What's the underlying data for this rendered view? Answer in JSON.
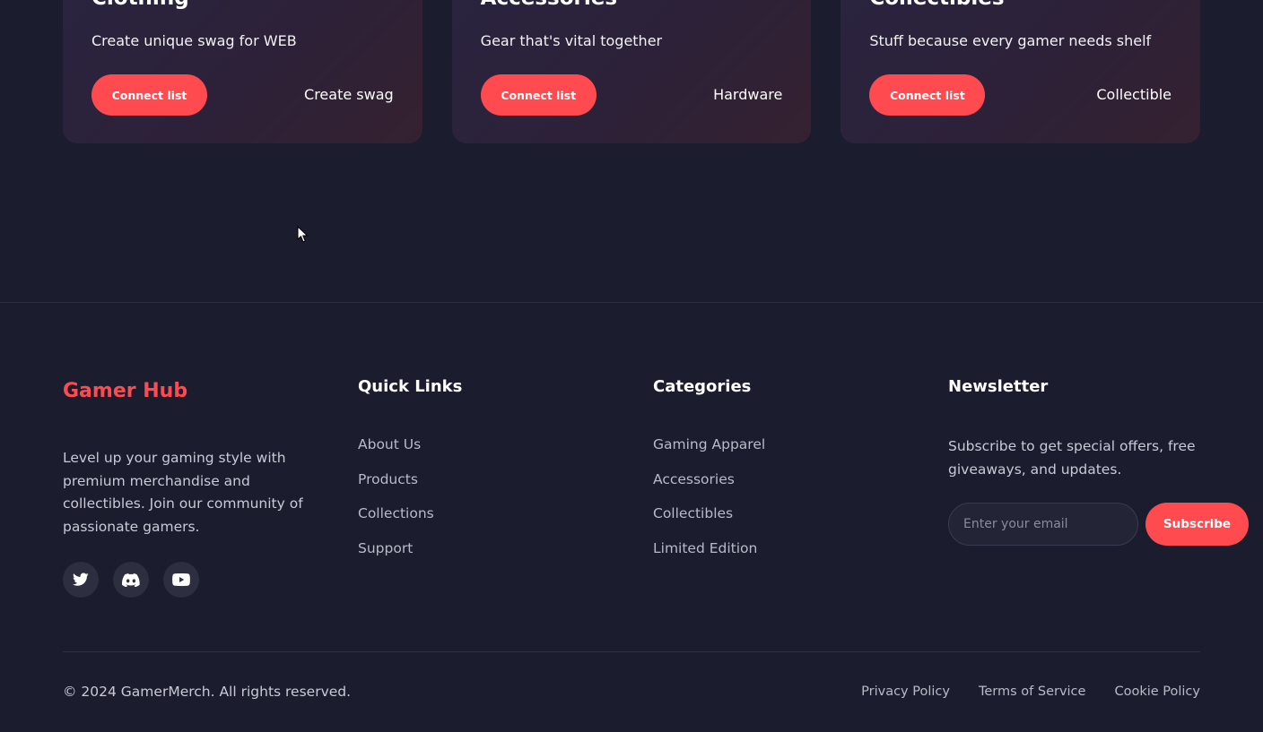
{
  "cards": [
    {
      "title": "Clothing",
      "description": "Create unique swag for WEB",
      "button_label": "Connect list",
      "tag": "Create swag"
    },
    {
      "title": "Accessories",
      "description": "Gear that's vital together",
      "button_label": "Connect list",
      "tag": "Hardware"
    },
    {
      "title": "Collectibles",
      "description": "Stuff because every gamer needs shelf",
      "button_label": "Connect list",
      "tag": "Collectible"
    }
  ],
  "footer": {
    "brand": {
      "name": "Gamer Hub",
      "description": "Level up your gaming style with premium merchandise and collectibles. Join our community of passionate gamers.",
      "socials": [
        "twitter-icon",
        "discord-icon",
        "youtube-icon"
      ]
    },
    "quick_links": {
      "heading": "Quick Links",
      "items": [
        "About Us",
        "Products",
        "Collections",
        "Support"
      ]
    },
    "categories": {
      "heading": "Categories",
      "items": [
        "Gaming Apparel",
        "Accessories",
        "Collectibles",
        "Limited Edition"
      ]
    },
    "newsletter": {
      "heading": "Newsletter",
      "description": "Subscribe to get special offers, free giveaways, and updates.",
      "email_placeholder": "Enter your email",
      "button_label": "Subscribe"
    },
    "copyright": "© 2024 GamerMerch. All rights reserved.",
    "legal_links": [
      "Privacy Policy",
      "Terms of Service",
      "Cookie Policy"
    ]
  },
  "colors": {
    "background": "#1b1c2e",
    "accent": "#ff4b4f",
    "card_gradient_start": "#2a2440",
    "card_gradient_end": "#352130",
    "muted_text": "#b9bac8"
  }
}
